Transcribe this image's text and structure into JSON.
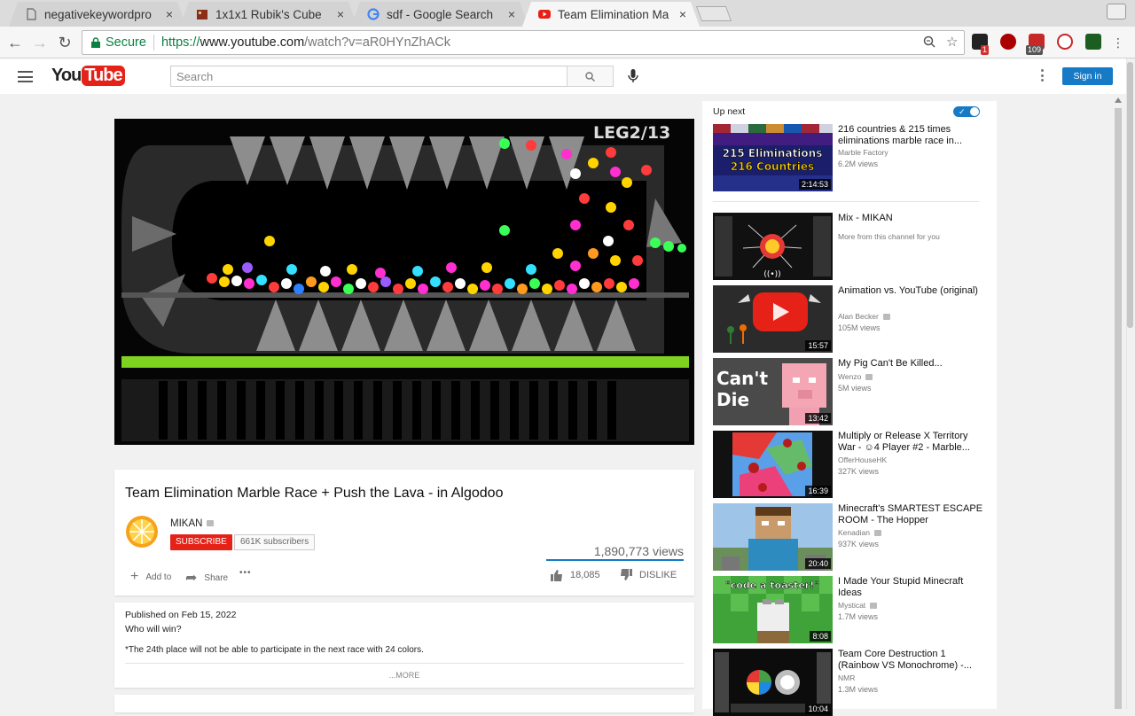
{
  "browser": {
    "tabs": [
      {
        "title": "negativekeywordpro"
      },
      {
        "title": "1x1x1 Rubik's Cube"
      },
      {
        "title": "sdf - Google Search"
      },
      {
        "title": "Team Elimination Ma"
      }
    ],
    "close_glyph": "×",
    "secure_label": "Secure",
    "url_protocol": "https://",
    "url_host": "www.youtube.com",
    "url_path": "/watch?v=aR0HYnZhACk",
    "ext_badges": [
      "1",
      "109"
    ]
  },
  "youtube": {
    "logo_you": "You",
    "logo_tube": "Tube",
    "search_placeholder": "Search",
    "sign_in": "Sign in"
  },
  "player": {
    "overlay_text": "LEG2/13"
  },
  "video": {
    "title": "Team Elimination Marble Race + Push the Lava - in Algodoo",
    "channel": "MIKAN",
    "subscribe_label": "SUBSCRIBE",
    "subscriber_count": "661K subscribers",
    "views": "1,890,773 views",
    "add_to": "Add to",
    "share": "Share",
    "more_actions": "•••",
    "likes": "18,085",
    "dislike": "DISLIKE",
    "published": "Published on Feb 15, 2022",
    "description_line1": "Who will win?",
    "description_line2": "*The 24th place will not be able to participate in the next race with 24 colors.",
    "show_more": "...MORE"
  },
  "up_next": {
    "label": "Up next",
    "toggle_check": "✓",
    "first": {
      "title": "216 countries & 215 times eliminations marble race in...",
      "channel": "Marble Factory",
      "views": "6.2M views",
      "duration": "2:14:53",
      "thumb_text1": "215 Eliminations",
      "thumb_text2": "216 Countries"
    },
    "items": [
      {
        "title": "Mix - MIKAN",
        "channel": "More from this channel for you",
        "views": "",
        "duration": ""
      },
      {
        "title": "Animation vs. YouTube (original)",
        "channel": "Alan Becker",
        "views": "105M views",
        "duration": "15:57"
      },
      {
        "title": "My Pig Can't Be Killed...",
        "channel": "Wenzo",
        "views": "5M views",
        "duration": "13:42",
        "thumb_text1": "Can't",
        "thumb_text2": "Die"
      },
      {
        "title": "Multiply or Release X Territory War - ☺4 Player #2 - Marble...",
        "channel": "OfferHouseHK",
        "views": "327K views",
        "duration": "16:39"
      },
      {
        "title": "Minecraft's SMARTEST ESCAPE ROOM - The Hopper",
        "channel": "Kenadian",
        "views": "937K views",
        "duration": "20:40"
      },
      {
        "title": "I Made Your Stupid Minecraft Ideas",
        "channel": "Mysticat",
        "views": "1.7M views",
        "duration": "8:08",
        "thumb_text1": "\"code a toaster!\""
      },
      {
        "title": "Team Core Destruction 1 (Rainbow VS Monochrome) -...",
        "channel": "NMR",
        "views": "1.3M views",
        "duration": "10:04"
      }
    ]
  }
}
